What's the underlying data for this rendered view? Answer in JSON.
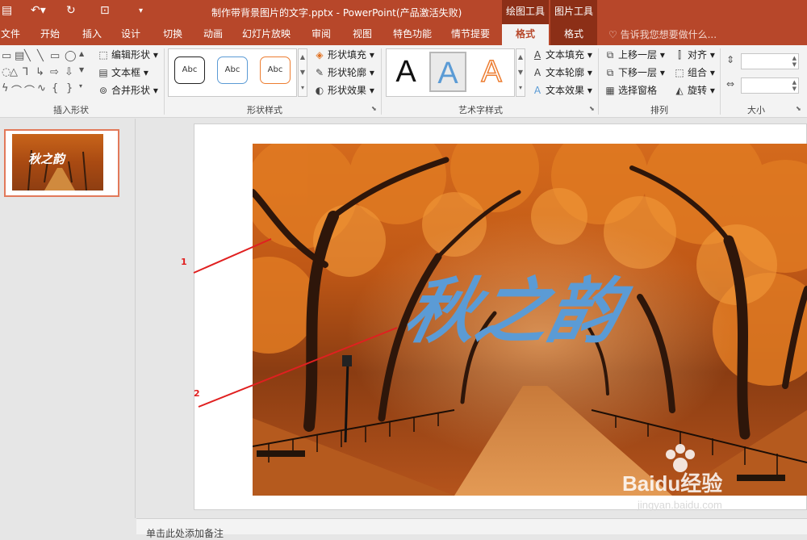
{
  "titlebar": {
    "document_title": "制作带背景图片的文字.pptx - PowerPoint(产品激活失败)",
    "contextual_groups": [
      "绘图工具",
      "图片工具"
    ]
  },
  "tabs": [
    {
      "label": "文件"
    },
    {
      "label": "开始"
    },
    {
      "label": "插入"
    },
    {
      "label": "设计"
    },
    {
      "label": "切换"
    },
    {
      "label": "动画"
    },
    {
      "label": "幻灯片放映"
    },
    {
      "label": "审阅"
    },
    {
      "label": "视图"
    },
    {
      "label": "特色功能"
    },
    {
      "label": "情节提要"
    },
    {
      "label": "格式",
      "active": true
    },
    {
      "label": "格式"
    }
  ],
  "tell_me": "告诉我您想要做什么...",
  "ribbon": {
    "insert_shapes": {
      "label": "插入形状",
      "edit_shape": "编辑形状",
      "text_box": "文本框",
      "merge_shapes": "合并形状"
    },
    "shape_styles": {
      "label": "形状样式",
      "presets": [
        "Abc",
        "Abc",
        "Abc"
      ],
      "fill": "形状填充",
      "outline": "形状轮廓",
      "effects": "形状效果"
    },
    "wordart_styles": {
      "label": "艺术字样式",
      "presets": [
        "A",
        "A",
        "A"
      ],
      "text_fill": "文本填充",
      "text_outline": "文本轮廓",
      "text_effects": "文本效果"
    },
    "arrange": {
      "label": "排列",
      "bring_forward": "上移一层",
      "send_backward": "下移一层",
      "selection_pane": "选择窗格",
      "align": "对齐",
      "group": "组合",
      "rotate": "旋转"
    },
    "size": {
      "label": "大小"
    }
  },
  "thumbnail": {
    "slide_number": "1",
    "text": "秋之韵"
  },
  "slide": {
    "wordart_text": "秋之韵"
  },
  "annotations": [
    "1",
    "2"
  ],
  "watermark": {
    "logo": "Baidu经验",
    "url": "jingyan.baidu.com"
  },
  "notes": "单击此处添加备注",
  "colors": {
    "accent": "#b7472a",
    "wordart_fill": "#5b9bd5",
    "annotation": "#e02020"
  }
}
